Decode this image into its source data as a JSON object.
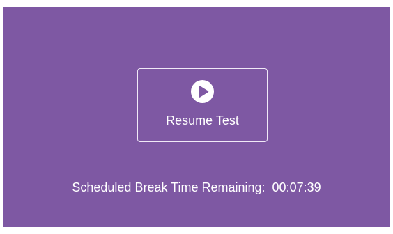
{
  "resume_button": {
    "icon": "play-icon",
    "label": "Resume Test"
  },
  "break": {
    "label": "Scheduled Break Time Remaining:",
    "time": "00:07:39"
  },
  "colors": {
    "panel_background": "#7e58a3",
    "text": "#ffffff",
    "button_border": "#f1eaf7"
  }
}
